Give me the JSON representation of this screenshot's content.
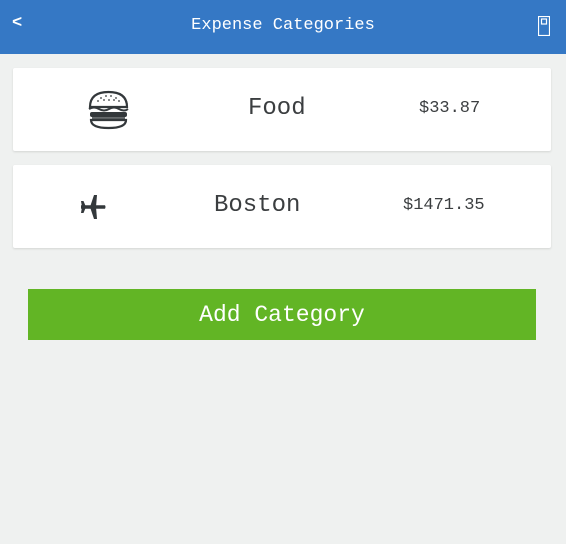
{
  "header": {
    "back_label": "<",
    "title": "Expense Categories",
    "device_icon": "device-icon"
  },
  "categories": [
    {
      "icon": "burger-icon",
      "name": "Food",
      "amount": "$33.87"
    },
    {
      "icon": "airplane-icon",
      "name": "Boston",
      "amount": "$1471.35"
    }
  ],
  "actions": {
    "add_category_label": "Add Category"
  },
  "colors": {
    "header": "#3578c5",
    "background": "#eff1f0",
    "add_button": "#62b525",
    "text": "#3b3e40"
  }
}
